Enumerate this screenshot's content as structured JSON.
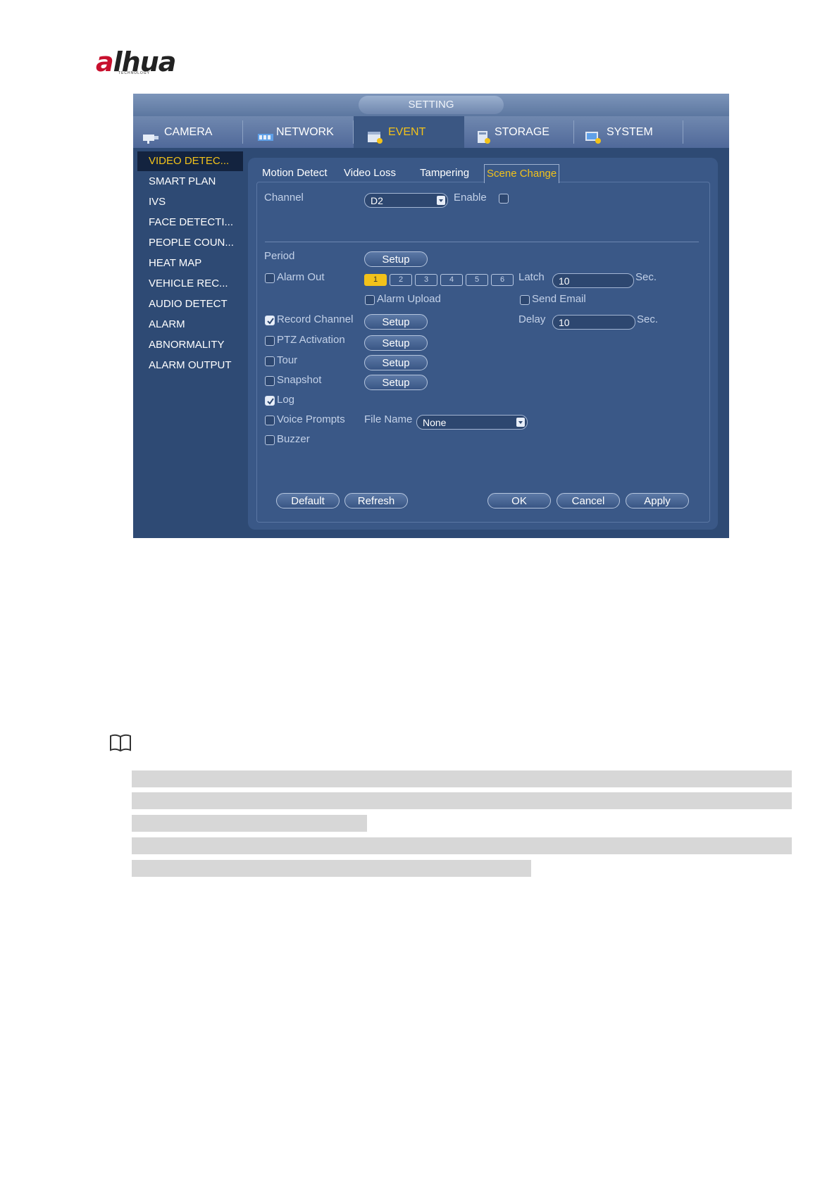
{
  "logo": {
    "brand": "alhua",
    "sub": "TECHNOLOGY"
  },
  "window": {
    "title": "SETTING",
    "main_tabs": [
      {
        "label": "CAMERA",
        "icon": "camera-icon",
        "active": false
      },
      {
        "label": "NETWORK",
        "icon": "network-icon",
        "active": false
      },
      {
        "label": "EVENT",
        "icon": "event-icon",
        "active": true
      },
      {
        "label": "STORAGE",
        "icon": "storage-icon",
        "active": false
      },
      {
        "label": "SYSTEM",
        "icon": "system-icon",
        "active": false
      }
    ],
    "sidebar": [
      {
        "label": "VIDEO DETEC...",
        "active": true
      },
      {
        "label": "SMART PLAN"
      },
      {
        "label": "IVS"
      },
      {
        "label": "FACE DETECTI..."
      },
      {
        "label": "PEOPLE COUN..."
      },
      {
        "label": "HEAT MAP"
      },
      {
        "label": "VEHICLE REC..."
      },
      {
        "label": "AUDIO DETECT"
      },
      {
        "label": "ALARM"
      },
      {
        "label": "ABNORMALITY"
      },
      {
        "label": "ALARM OUTPUT"
      }
    ],
    "sub_tabs": [
      {
        "label": "Motion Detect"
      },
      {
        "label": "Video Loss"
      },
      {
        "label": "Tampering"
      },
      {
        "label": "Scene Change",
        "active": true
      }
    ],
    "form": {
      "channel_label": "Channel",
      "channel_value": "D2",
      "enable_label": "Enable",
      "period_label": "Period",
      "setup": "Setup",
      "alarm_out_label": "Alarm Out",
      "alarm_out_numbers": [
        "1",
        "2",
        "3",
        "4",
        "5",
        "6"
      ],
      "latch_label": "Latch",
      "latch_value": "10",
      "sec": "Sec.",
      "alarm_upload_label": "Alarm Upload",
      "send_email_label": "Send Email",
      "record_channel_label": "Record Channel",
      "delay_label": "Delay",
      "delay_value": "10",
      "ptz_label": "PTZ Activation",
      "tour_label": "Tour",
      "snapshot_label": "Snapshot",
      "log_label": "Log",
      "voice_label": "Voice Prompts",
      "file_name_label": "File Name",
      "file_name_value": "None",
      "buzzer_label": "Buzzer"
    },
    "buttons": {
      "default": "Default",
      "refresh": "Refresh",
      "ok": "OK",
      "cancel": "Cancel",
      "apply": "Apply"
    }
  },
  "colors": {
    "active_accent": "#f2c21a",
    "window_bg": "#2e4a74",
    "redaction": "#d7d7d7"
  }
}
